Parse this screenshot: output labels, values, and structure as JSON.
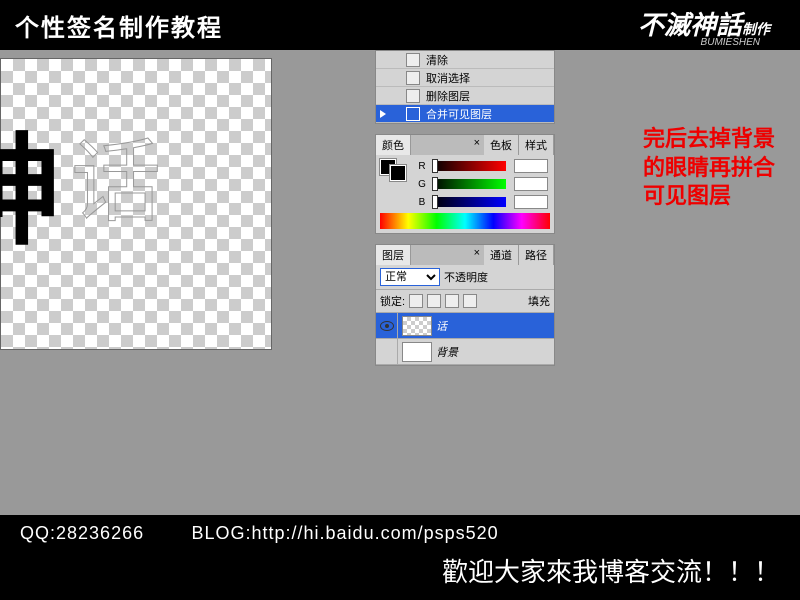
{
  "banner": {
    "title": "个性签名制作教程",
    "logo": "不滅神話",
    "logoSuffix": "制作",
    "logoSub": "BUMIESHEN"
  },
  "canvas": {
    "char1": "神",
    "char2": "话"
  },
  "history": {
    "items": [
      {
        "label": "清除"
      },
      {
        "label": "取消选择"
      },
      {
        "label": "删除图层"
      },
      {
        "label": "合并可见图层",
        "selected": true
      }
    ]
  },
  "colorPanel": {
    "tabs": {
      "color": "颜色",
      "swatches": "色板",
      "styles": "样式"
    },
    "r": {
      "label": "R",
      "value": ""
    },
    "g": {
      "label": "G",
      "value": ""
    },
    "b": {
      "label": "B",
      "value": ""
    }
  },
  "layersPanel": {
    "tabs": {
      "layers": "图层",
      "channels": "通道",
      "paths": "路径"
    },
    "blendLabel": "正常",
    "opacityLabel": "不透明度",
    "lockLabel": "锁定:",
    "fillLabel": "填充",
    "layers": [
      {
        "name": "话",
        "selected": true,
        "visible": true
      },
      {
        "name": "背景",
        "selected": false,
        "visible": false
      }
    ]
  },
  "instruction": {
    "line1": "完后去掉背景",
    "line2": "的眼睛再拼合",
    "line3": "可见图层"
  },
  "footer": {
    "qqLabel": "QQ:",
    "qq": "28236266",
    "blogLabel": "BLOG:",
    "blog": "http://hi.baidu.com/psps520",
    "welcome": "歡迎大家來我博客交流！！！"
  }
}
